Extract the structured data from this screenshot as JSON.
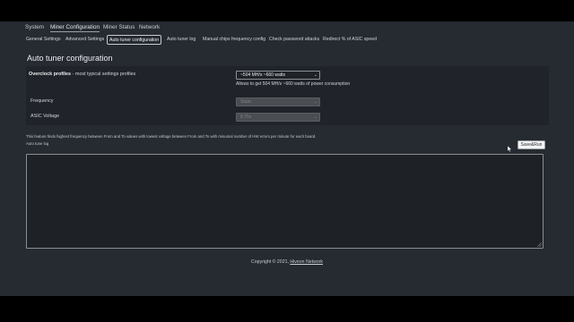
{
  "topnav": [
    {
      "label": "System",
      "active": false
    },
    {
      "label": "Miner Configuration",
      "active": true
    },
    {
      "label": "Miner Status",
      "active": false
    },
    {
      "label": "Network",
      "active": false
    }
  ],
  "subnav": [
    {
      "label": "General Settings",
      "active": false
    },
    {
      "label": "Advanced Settings",
      "active": false
    },
    {
      "label": "Auto tuner configuration",
      "active": true
    },
    {
      "label": "Auto tuner log",
      "active": false
    },
    {
      "label": "Manual chips frequency config",
      "active": false
    },
    {
      "label": "Check password attacks",
      "active": false
    },
    {
      "label": "Redirect % of ASIC speed",
      "active": false
    }
  ],
  "page_title": "Auto tuner configuration",
  "overclock": {
    "label_bold": "Overclock profiles",
    "label_rest": " - most typical settings profiles",
    "selected": "~504 MH/s ~660 watts",
    "hint": "Allows to get 504 MH/s ~660 watts of power consumption"
  },
  "frequency": {
    "label": "Frequency",
    "value": "Static"
  },
  "asic_voltage": {
    "label": "ASIC Voltage",
    "value": "8.75v"
  },
  "feature_note": "This feature finds highest frequency between From and To values with lowest voltage between From and To with minumal number of HW errors per minute for each board.",
  "log_label": "Auto tune log",
  "save_button": "Save&Run",
  "footer": {
    "prefix": "Copyright © 2021,",
    "link": "Hiveon Network"
  }
}
